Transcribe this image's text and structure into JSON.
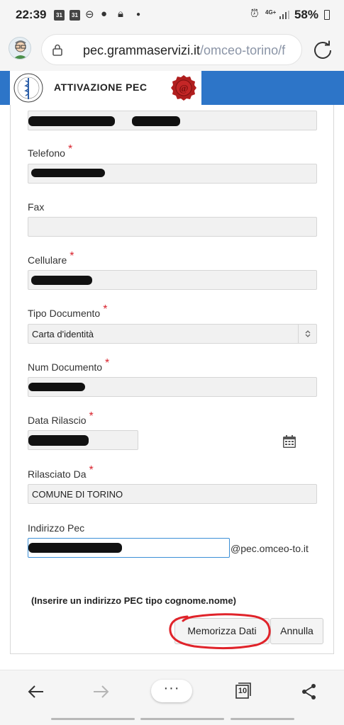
{
  "status_bar": {
    "time": "22:39",
    "calendar_day_1": "31",
    "calendar_day_2": "31",
    "network": "4G+",
    "battery": "58%"
  },
  "browser": {
    "url_host": "pec.grammaservizi.it",
    "url_path": "/omceo-torino/f",
    "tabs_count": "10",
    "menu_label": "···"
  },
  "header": {
    "title": "ATTIVAZIONE PEC"
  },
  "form": {
    "email_value": "e@",
    "telefono_label": "Telefono",
    "fax_label": "Fax",
    "cellulare_label": "Cellulare",
    "tipo_documento_label": "Tipo Documento",
    "tipo_documento_value": "Carta d'identità",
    "num_documento_label": "Num Documento",
    "data_rilascio_label": "Data Rilascio",
    "rilasciato_da_label": "Rilasciato Da",
    "rilasciato_da_value": "COMUNE DI TORINO",
    "indirizzo_pec_label": "Indirizzo Pec",
    "pec_domain": "@pec.omceo-to.it",
    "required_mark": "*",
    "note": "(Inserire un indirizzo PEC tipo cognome.nome)"
  },
  "buttons": {
    "save_label": "Memorizza Dati",
    "cancel_label": "Annulla"
  },
  "colors": {
    "header_blue": "#2d75c8",
    "required_red": "#d9232d",
    "annotation_red": "#e0232a",
    "focus_blue": "#3b8fd6"
  }
}
